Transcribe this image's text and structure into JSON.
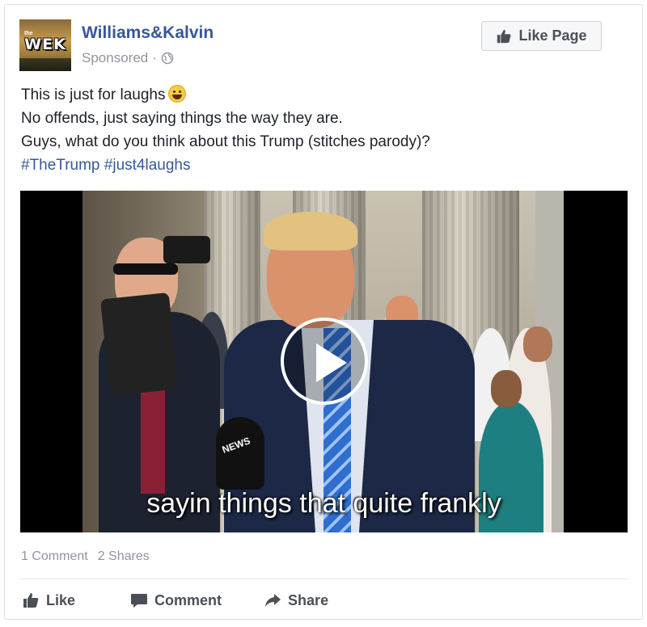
{
  "post": {
    "page_name": "Williams&Kalvin",
    "sponsored_label": "Sponsored",
    "separator": "·",
    "avatar_logo_text": "WEK",
    "avatar_logo_small": "the",
    "like_page_label": "Like Page",
    "text_lines": [
      "This is just for laughs",
      "No offends, just saying things the way they are.",
      "Guys, what do you think about this Trump (stitches parody)?"
    ],
    "hashtags": [
      "#TheTrump",
      "#just4laughs"
    ],
    "video": {
      "caption": "sayin things that quite frankly",
      "mic_label": "NEWS"
    },
    "stats": {
      "comments": "1 Comment",
      "shares": "2 Shares"
    },
    "actions": {
      "like": "Like",
      "comment": "Comment",
      "share": "Share"
    }
  },
  "colors": {
    "link_blue": "#365899",
    "meta_gray": "#90949c",
    "action_gray": "#4b4f56",
    "text": "#1d2129"
  },
  "icons": [
    "globe-icon",
    "thumbs-up-icon",
    "comment-bubble-icon",
    "share-arrow-icon",
    "play-icon",
    "grinning-emoji-icon"
  ]
}
